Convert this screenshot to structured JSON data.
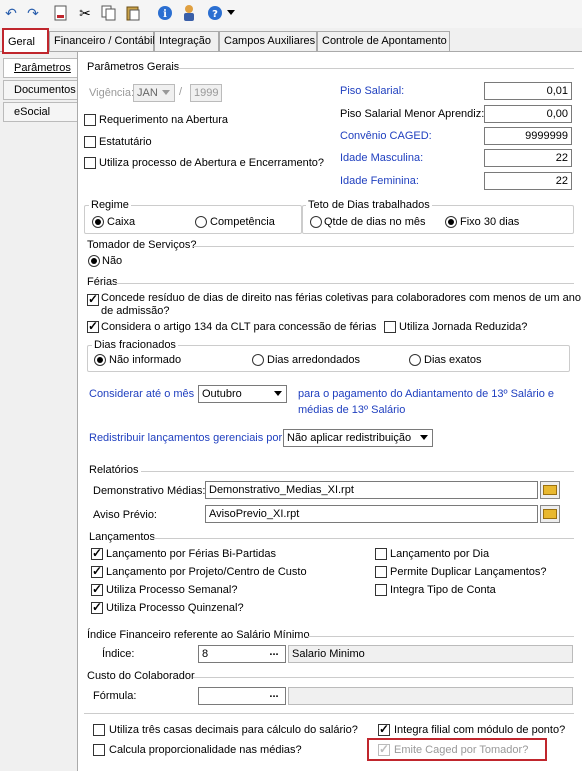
{
  "toolbar": {
    "icons": [
      "undo-icon",
      "redo-icon",
      "new-document-icon",
      "cut-icon",
      "copy-icon",
      "paste-icon",
      "info-icon",
      "user-icon",
      "help-icon"
    ]
  },
  "tabs": [
    "Geral",
    "Financeiro / Contábil",
    "Integração",
    "Campos Auxiliares",
    "Controle de Apontamento"
  ],
  "side_tabs": [
    "Parâmetros",
    "Documentos",
    "eSocial"
  ],
  "gerais": {
    "title": "Parâmetros Gerais",
    "vigencia_label": "Vigência:",
    "vigencia_month": "JAN",
    "vigencia_sep": "/",
    "vigencia_year": "1999",
    "requerimento": "Requerimento na Abertura",
    "estatutario": "Estatutário",
    "utiliza_processo": "Utiliza processo de Abertura e Encerramento?",
    "piso_salarial_label": "Piso Salarial:",
    "piso_salarial": "0,01",
    "piso_menor_label": "Piso Salarial Menor Aprendiz:",
    "piso_menor": "0,00",
    "convenio_label": "Convênio CAGED:",
    "convenio": "9999999",
    "idade_masc_label": "Idade Masculina:",
    "idade_masc": "22",
    "idade_fem_label": "Idade Feminina:",
    "idade_fem": "22"
  },
  "regime": {
    "title": "Regime",
    "caixa": "Caixa",
    "competencia": "Competência"
  },
  "teto": {
    "title": "Teto de Dias trabalhados",
    "qtde": "Qtde de dias no mês",
    "fixo": "Fixo 30 dias"
  },
  "tomador": {
    "title": "Tomador de Serviços?",
    "nao": "Não"
  },
  "ferias": {
    "title": "Férias",
    "concede": "Concede resíduo de dias de direito nas férias coletivas para colaboradores com menos de um ano",
    "concede2": "de admissão?",
    "considera": "Considera o artigo 134 da CLT para concessão de férias",
    "jornada": "Utiliza Jornada Reduzida?",
    "dias_title": "Dias fracionados",
    "nao_informado": "Não informado",
    "arredondados": "Dias arredondados",
    "exatos": "Dias exatos"
  },
  "adiantamento": {
    "label": "Considerar até o mês",
    "mes": "Outubro",
    "texto1": "para o pagamento do Adiantamento de 13º Salário e",
    "texto2": "médias de 13º Salário"
  },
  "redistribuir": {
    "label": "Redistribuir lançamentos gerenciais por:",
    "value": "Não aplicar redistribuição"
  },
  "relatorios": {
    "title": "Relatórios",
    "medias_label": "Demonstrativo Médias:",
    "medias": "Demonstrativo_Medias_XI.rpt",
    "aviso_label": "Aviso Prévio:",
    "aviso": "AvisoPrevio_XI.rpt"
  },
  "lancamentos": {
    "title": "Lançamentos",
    "bi_partidas": "Lançamento por Férias Bi-Partidas",
    "projeto": "Lançamento por Projeto/Centro de Custo",
    "semanal": "Utiliza Processo Semanal?",
    "quinzenal": "Utiliza Processo Quinzenal?",
    "por_dia": "Lançamento por Dia",
    "duplicar": "Permite Duplicar Lançamentos?",
    "integra_tipo": "Integra Tipo de Conta"
  },
  "indice": {
    "title": "Índice Financeiro referente ao Salário Mínimo",
    "label": "Índice:",
    "value": "8",
    "dots": "...",
    "desc": "Salario Minimo"
  },
  "custo": {
    "title": "Custo do Colaborador",
    "label": "Fórmula:",
    "value": "",
    "dots": "..."
  },
  "rodape": {
    "tres_casas": "Utiliza três casas decimais para cálculo do salário?",
    "proporcional": "Calcula proporcionalidade nas médias?",
    "integra_filial": "Integra filial com módulo de ponto?",
    "emite_caged": "Emite Caged por Tomador?"
  },
  "colors": {
    "accent_red": "#c0262d",
    "label_blue": "#1f3fbf"
  }
}
